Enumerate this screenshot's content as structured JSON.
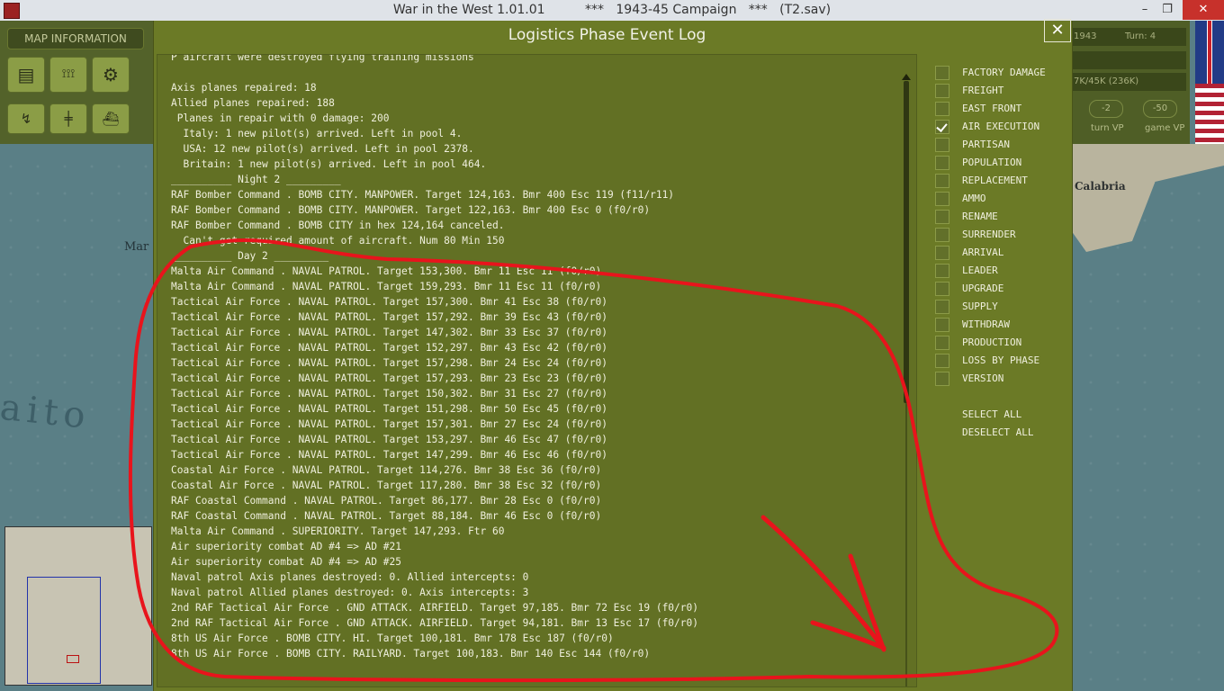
{
  "window": {
    "title": "War in the West 1.01.01          ***   1943-45 Campaign   ***   (T2.sav)",
    "minimize_glyph": "–",
    "restore_glyph": "❐",
    "close_glyph": "✕"
  },
  "left_panel": {
    "map_info_tab": "MAP INFORMATION",
    "tools": [
      "tank-icon",
      "units-icon",
      "gear-icon",
      "aircraft-icon",
      "railway-icon",
      "ships-icon"
    ],
    "tool_glyphs": [
      "▤",
      "⟟⟟⟟",
      "⚙",
      "↯",
      "╪",
      "⛴"
    ],
    "map_label": "Mar",
    "sea_label": "aito"
  },
  "right_panel": {
    "date": "1943",
    "turn": "Turn: 4",
    "field_values": [
      "",
      "7K/45K (236K)"
    ],
    "turn_vp_value": "-2",
    "game_vp_value": "-50",
    "turn_vp_label": "turn VP",
    "game_vp_label": "game VP",
    "map_label": "Calabria"
  },
  "dialog": {
    "title": "Logistics Phase Event Log",
    "close_glyph": "✕",
    "log_lines": [
      "P aircraft were destroyed flying training missions",
      "",
      "Axis planes repaired: 18",
      "Allied planes repaired: 188",
      " Planes in repair with 0 damage: 200",
      "  Italy: 1 new pilot(s) arrived. Left in pool 4.",
      "  USA: 12 new pilot(s) arrived. Left in pool 2378.",
      "  Britain: 1 new pilot(s) arrived. Left in pool 464.",
      "__________ Night 2 _________",
      "RAF Bomber Command . BOMB CITY. MANPOWER. Target 124,163. Bmr 400 Esc 119 (f11/r11)",
      "RAF Bomber Command . BOMB CITY. MANPOWER. Target 122,163. Bmr 400 Esc 0 (f0/r0)",
      "RAF Bomber Command . BOMB CITY in hex 124,164 canceled.",
      "  Can't get required amount of aircraft. Num 80 Min 150",
      "__________ Day 2 _________",
      "Malta Air Command . NAVAL PATROL. Target 153,300. Bmr 11 Esc 11 (f0/r0)",
      "Malta Air Command . NAVAL PATROL. Target 159,293. Bmr 11 Esc 11 (f0/r0)",
      "Tactical Air Force . NAVAL PATROL. Target 157,300. Bmr 41 Esc 38 (f0/r0)",
      "Tactical Air Force . NAVAL PATROL. Target 157,292. Bmr 39 Esc 43 (f0/r0)",
      "Tactical Air Force . NAVAL PATROL. Target 147,302. Bmr 33 Esc 37 (f0/r0)",
      "Tactical Air Force . NAVAL PATROL. Target 152,297. Bmr 43 Esc 42 (f0/r0)",
      "Tactical Air Force . NAVAL PATROL. Target 157,298. Bmr 24 Esc 24 (f0/r0)",
      "Tactical Air Force . NAVAL PATROL. Target 157,293. Bmr 23 Esc 23 (f0/r0)",
      "Tactical Air Force . NAVAL PATROL. Target 150,302. Bmr 31 Esc 27 (f0/r0)",
      "Tactical Air Force . NAVAL PATROL. Target 151,298. Bmr 50 Esc 45 (f0/r0)",
      "Tactical Air Force . NAVAL PATROL. Target 157,301. Bmr 27 Esc 24 (f0/r0)",
      "Tactical Air Force . NAVAL PATROL. Target 153,297. Bmr 46 Esc 47 (f0/r0)",
      "Tactical Air Force . NAVAL PATROL. Target 147,299. Bmr 46 Esc 46 (f0/r0)",
      "Coastal Air Force . NAVAL PATROL. Target 114,276. Bmr 38 Esc 36 (f0/r0)",
      "Coastal Air Force . NAVAL PATROL. Target 117,280. Bmr 38 Esc 32 (f0/r0)",
      "RAF Coastal Command . NAVAL PATROL. Target 86,177. Bmr 28 Esc 0 (f0/r0)",
      "RAF Coastal Command . NAVAL PATROL. Target 88,184. Bmr 46 Esc 0 (f0/r0)",
      "Malta Air Command . SUPERIORITY. Target 147,293. Ftr 60",
      "Air superiority combat AD #4 => AD #21",
      "Air superiority combat AD #4 => AD #25",
      "Naval patrol Axis planes destroyed: 0. Allied intercepts: 0",
      "Naval patrol Allied planes destroyed: 0. Axis intercepts: 3",
      "2nd RAF Tactical Air Force . GND ATTACK. AIRFIELD. Target 97,185. Bmr 72 Esc 19 (f0/r0)",
      "2nd RAF Tactical Air Force . GND ATTACK. AIRFIELD. Target 94,181. Bmr 13 Esc 17 (f0/r0)",
      "8th US Air Force . BOMB CITY. HI. Target 100,181. Bmr 178 Esc 187 (f0/r0)",
      "8th US Air Force . BOMB CITY. RAILYARD. Target 100,183. Bmr 140 Esc 144 (f0/r0)"
    ],
    "scroll_position": 0.52,
    "filters": [
      {
        "label": "FACTORY DAMAGE",
        "checked": false
      },
      {
        "label": "FREIGHT",
        "checked": false
      },
      {
        "label": "EAST FRONT",
        "checked": false
      },
      {
        "label": "AIR EXECUTION",
        "checked": true
      },
      {
        "label": "PARTISAN",
        "checked": false
      },
      {
        "label": "POPULATION",
        "checked": false
      },
      {
        "label": "REPLACEMENT",
        "checked": false
      },
      {
        "label": "AMMO",
        "checked": false
      },
      {
        "label": "RENAME",
        "checked": false
      },
      {
        "label": "SURRENDER",
        "checked": false
      },
      {
        "label": "ARRIVAL",
        "checked": false
      },
      {
        "label": "LEADER",
        "checked": false
      },
      {
        "label": "UPGRADE",
        "checked": false
      },
      {
        "label": "SUPPLY",
        "checked": false
      },
      {
        "label": "WITHDRAW",
        "checked": false
      },
      {
        "label": "PRODUCTION",
        "checked": false
      },
      {
        "label": "LOSS BY PHASE",
        "checked": false
      },
      {
        "label": "VERSION",
        "checked": false
      }
    ],
    "select_all": "SELECT ALL",
    "deselect_all": "DESELECT ALL"
  },
  "annotation": {
    "color": "#e8141c"
  }
}
